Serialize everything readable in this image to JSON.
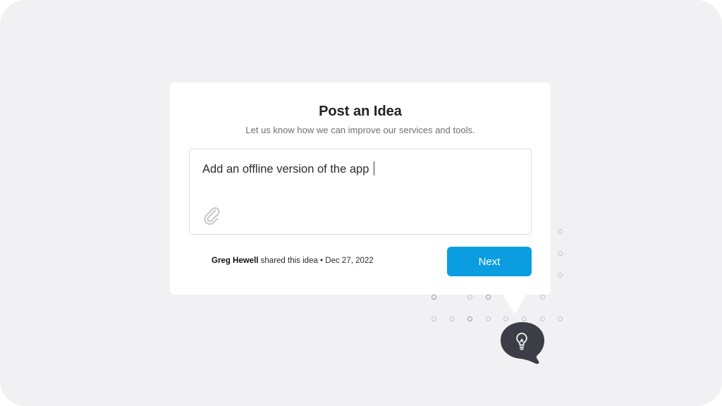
{
  "dialog": {
    "title": "Post an Idea",
    "subtitle": "Let us know how we can improve our services and tools."
  },
  "idea_input": {
    "value": "Add an offline version of the app"
  },
  "attachment": {
    "icon": "paperclip-icon"
  },
  "footer": {
    "author": "Greg Hewell",
    "shared_text": " shared this idea • Dec 27, 2022",
    "next_label": "Next"
  },
  "bubble": {
    "icon": "lightbulb-icon",
    "background": "#3c3d46"
  },
  "colors": {
    "accent": "#0a9ee0",
    "background": "#f1f1f3",
    "card": "#ffffff"
  }
}
